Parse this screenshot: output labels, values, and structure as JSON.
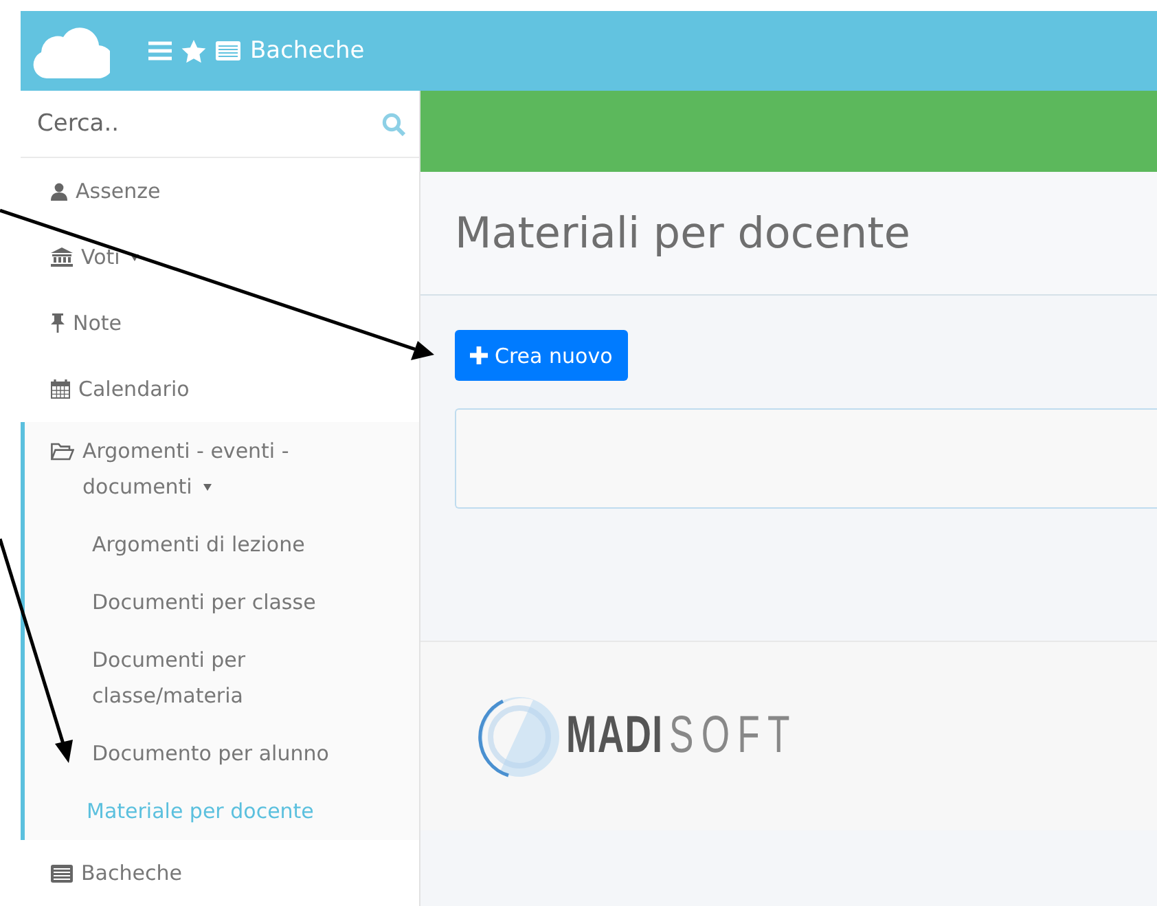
{
  "header": {
    "title": "Bacheche"
  },
  "sidebar": {
    "search": {
      "placeholder": "Cerca.."
    },
    "items": [
      {
        "label": "Assenze",
        "kind": "link"
      },
      {
        "label": "Voti",
        "kind": "dropdown",
        "expanded": false
      },
      {
        "label": "Note",
        "kind": "link"
      },
      {
        "label": "Calendario",
        "kind": "link"
      },
      {
        "label": "Argomenti - eventi - documenti",
        "kind": "dropdown",
        "expanded": true,
        "children": [
          {
            "label": "Argomenti di lezione",
            "selected": false
          },
          {
            "label": "Documenti per classe",
            "selected": false
          },
          {
            "label": "Documenti per classe/materia",
            "selected": false
          },
          {
            "label": "Documento per alunno",
            "selected": false
          },
          {
            "label": "Materiale per docente",
            "selected": true
          }
        ]
      },
      {
        "label": "Bacheche",
        "kind": "link"
      }
    ]
  },
  "main": {
    "title": "Materiali per docente",
    "create_button": "Crea nuovo"
  },
  "footer": {
    "logo": {
      "bold": "MADI",
      "light": "SOFT"
    }
  }
}
